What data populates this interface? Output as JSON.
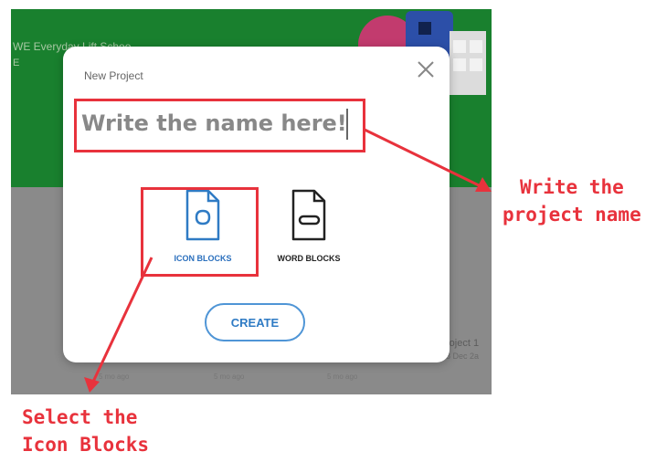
{
  "app": {
    "title": "WE Everyday Lift Schoo",
    "subtitle": "E",
    "project_card_label": "roject 1",
    "project_card_date": "8 Dec 2a",
    "dates": [
      "5 mo ago",
      "5 mo ago",
      "5 mo ago"
    ]
  },
  "modal": {
    "title": "New Project",
    "name_placeholder": "Write the name here!",
    "close_icon": "close-icon",
    "options": [
      {
        "label": "ICON BLOCKS",
        "icon": "icon-blocks-file-icon",
        "selected": true
      },
      {
        "label": "WORD BLOCKS",
        "icon": "word-blocks-file-icon",
        "selected": false
      }
    ],
    "create_label": "CREATE"
  },
  "annotations": {
    "name_callout": "Write the\nproject name",
    "icon_callout": "Select the\nIcon Blocks",
    "color": "#e8323c"
  },
  "colors": {
    "header_green": "#19802e",
    "accent_blue": "#2f7bc4",
    "overlay_gray": "#8c8c8c"
  }
}
